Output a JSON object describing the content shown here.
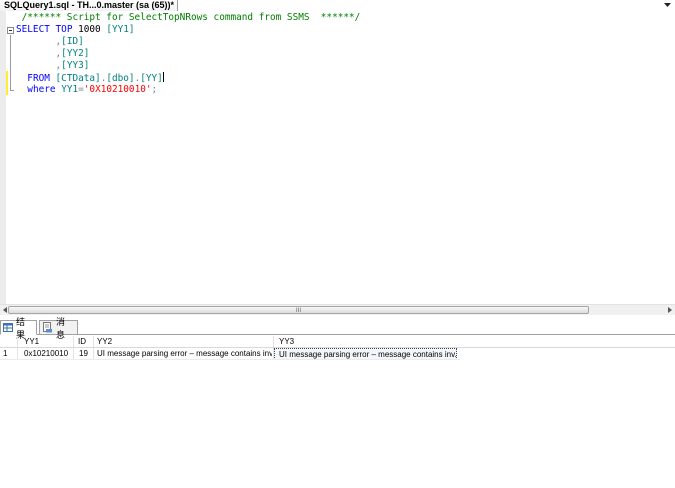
{
  "document_tab": {
    "title": "SQLQuery1.sql - TH...0.master (sa (65))*"
  },
  "editor": {
    "lines": [
      {
        "segments": [
          {
            "text": " /****** Script for SelectTopNRows command from SSMS  ******/",
            "cls": "cm"
          }
        ]
      },
      {
        "segments": [
          {
            "text": "SELECT",
            "cls": "kw"
          },
          {
            "text": " ",
            "cls": "tx"
          },
          {
            "text": "TOP",
            "cls": "kw"
          },
          {
            "text": " 1000 ",
            "cls": "tx"
          },
          {
            "text": "[YY1]",
            "cls": "id"
          }
        ]
      },
      {
        "segments": [
          {
            "text": "       ",
            "cls": "tx"
          },
          {
            "text": ",",
            "cls": "gy"
          },
          {
            "text": "[ID]",
            "cls": "id"
          }
        ]
      },
      {
        "segments": [
          {
            "text": "       ",
            "cls": "tx"
          },
          {
            "text": ",",
            "cls": "gy"
          },
          {
            "text": "[YY2]",
            "cls": "id"
          }
        ]
      },
      {
        "segments": [
          {
            "text": "       ",
            "cls": "tx"
          },
          {
            "text": ",",
            "cls": "gy"
          },
          {
            "text": "[YY3]",
            "cls": "id"
          }
        ]
      },
      {
        "segments": [
          {
            "text": "  ",
            "cls": "tx"
          },
          {
            "text": "FROM",
            "cls": "kw"
          },
          {
            "text": " ",
            "cls": "tx"
          },
          {
            "text": "[CTData]",
            "cls": "id"
          },
          {
            "text": ".",
            "cls": "gy"
          },
          {
            "text": "[dbo]",
            "cls": "id"
          },
          {
            "text": ".",
            "cls": "gy"
          },
          {
            "text": "[YY]",
            "cls": "id"
          }
        ]
      },
      {
        "segments": [
          {
            "text": "  ",
            "cls": "tx"
          },
          {
            "text": "where",
            "cls": "kw"
          },
          {
            "text": " ",
            "cls": "tx"
          },
          {
            "text": "YY1",
            "cls": "id"
          },
          {
            "text": "=",
            "cls": "gy"
          },
          {
            "text": "'0X10210010'",
            "cls": "st"
          },
          {
            "text": ";",
            "cls": "gy"
          }
        ]
      }
    ]
  },
  "scrollbar": {
    "grip": "III"
  },
  "results_tabs": {
    "results_label": "结果",
    "messages_label": "消息"
  },
  "grid": {
    "columns": [
      "YY1",
      "ID",
      "YY2",
      "YY3"
    ],
    "rows": [
      {
        "row_number": "1",
        "yy1": "0x10210010",
        "id": "19",
        "yy2": "UI message parsing error – message contains inv...",
        "yy3": "UI message parsing error – message contains inv..."
      }
    ]
  }
}
